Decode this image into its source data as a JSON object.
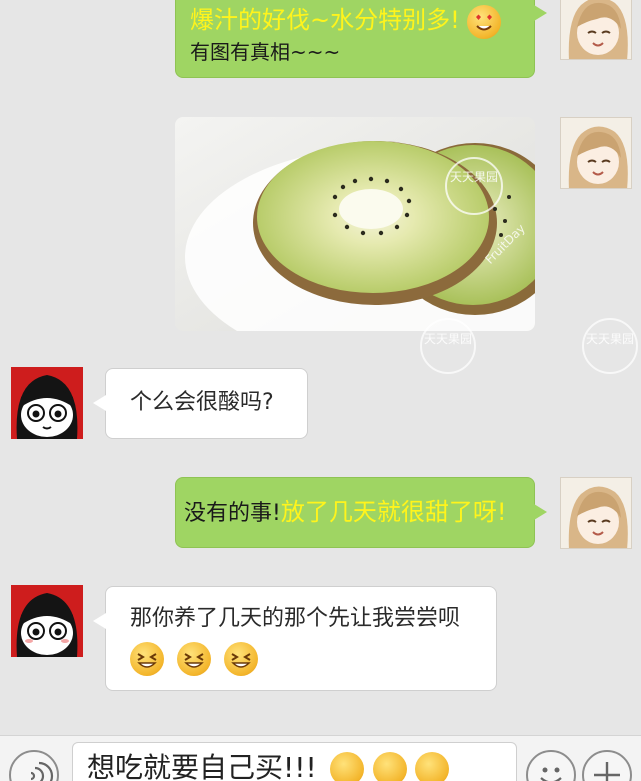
{
  "messages": {
    "m1": {
      "line1_highlight": "爆汁的好伐~水分特别多!",
      "line2": "有图有真相~~~"
    },
    "m3": {
      "text": "个么会很酸吗?"
    },
    "m4": {
      "plain": "没有的事!",
      "highlight": "放了几天就很甜了呀!"
    },
    "m5": {
      "text": "那你养了几天的那个先让我尝尝呗"
    }
  },
  "photo": {
    "watermark_cn": "天天果园",
    "watermark_en": "FruitDay"
  },
  "input": {
    "text": "想吃就要自己买!!!"
  },
  "icons": {
    "m1_emoji": "heart-eyes-face-icon",
    "m5_emoji": "grinning-squint-face-icon",
    "input_emoji": "sweat-smile-face-icon",
    "voice": "voice-icon",
    "emoji_button": "smiley-icon",
    "more": "plus-icon"
  },
  "colors": {
    "sent_bubble": "#9fd563",
    "received_bubble": "#ffffff",
    "highlight_text": "#fff41c",
    "background": "#e6e6e6"
  }
}
